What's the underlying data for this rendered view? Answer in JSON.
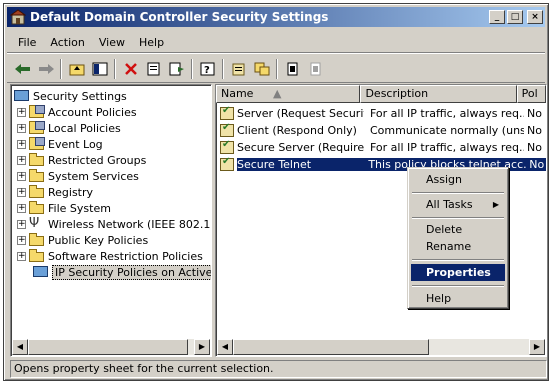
{
  "window": {
    "title": "Default Domain Controller Security Settings"
  },
  "titlebar_buttons": {
    "minimize": "_",
    "maximize": "□",
    "close": "×"
  },
  "menu": [
    {
      "label": "File"
    },
    {
      "label": "Action"
    },
    {
      "label": "View"
    },
    {
      "label": "Help"
    }
  ],
  "toolbar": {
    "icons": [
      "back-icon",
      "forward-icon",
      "up-folder-icon",
      "show-hide-tree-icon",
      "delete-icon",
      "properties-icon",
      "export-list-icon",
      "help-icon",
      "create-policy-icon",
      "manage-filters-icon",
      "assign-icon",
      "unassign-icon"
    ]
  },
  "tree": {
    "root": "Security Settings",
    "items": [
      {
        "label": "Account Policies"
      },
      {
        "label": "Local Policies"
      },
      {
        "label": "Event Log"
      },
      {
        "label": "Restricted Groups"
      },
      {
        "label": "System Services"
      },
      {
        "label": "Registry"
      },
      {
        "label": "File System"
      },
      {
        "label": "Wireless Network (IEEE 802.11)"
      },
      {
        "label": "Public Key Policies"
      },
      {
        "label": "Software Restriction Policies"
      },
      {
        "label": "IP Security Policies on Active Dire"
      }
    ]
  },
  "list": {
    "columns": [
      "Name",
      "Description",
      "Pol"
    ],
    "rows": [
      {
        "name": "Server (Request Security)",
        "description": "For all IP traffic, always req...",
        "assigned": "No"
      },
      {
        "name": "Client (Respond Only)",
        "description": "Communicate normally (uns...",
        "assigned": "No"
      },
      {
        "name": "Secure Server (Require...",
        "description": "For all IP traffic, always req...",
        "assigned": "No"
      },
      {
        "name": "Secure Telnet",
        "description": "This policy blocks telnet acc...",
        "assigned": "No"
      }
    ]
  },
  "context_menu": {
    "assign": "Assign",
    "all_tasks": "All Tasks",
    "delete": "Delete",
    "rename": "Rename",
    "properties": "Properties",
    "help": "Help"
  },
  "statusbar": {
    "text": "Opens property sheet for the current selection."
  },
  "colors": {
    "selection": "#0a246a",
    "face": "#d4d0c8"
  }
}
